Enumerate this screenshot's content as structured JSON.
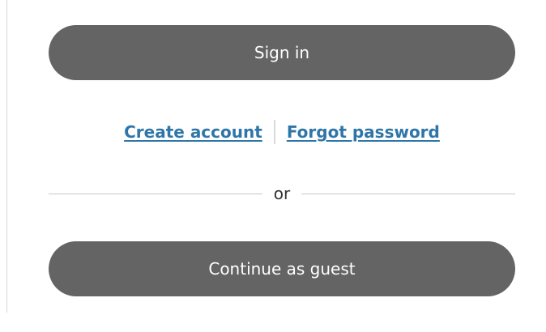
{
  "auth": {
    "sign_in_label": "Sign in",
    "create_account_label": "Create account",
    "forgot_password_label": "Forgot password",
    "divider_label": "or",
    "guest_label": "Continue as guest"
  },
  "colors": {
    "button_bg": "#646464",
    "button_text": "#ffffff",
    "link": "#2f76a8"
  }
}
